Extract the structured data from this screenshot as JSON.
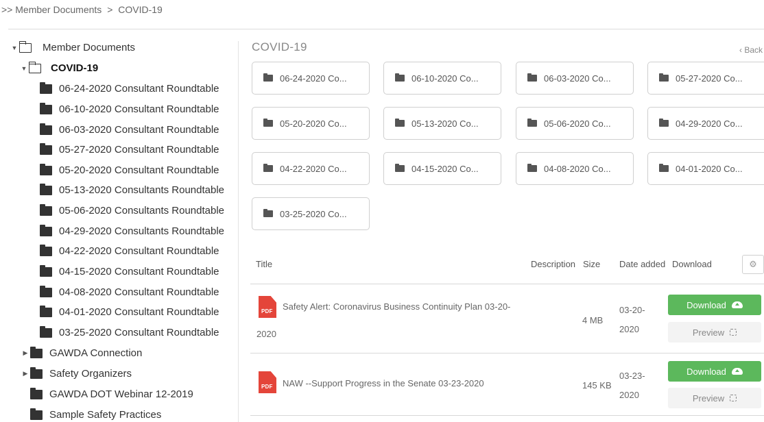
{
  "breadcrumb": {
    "prefix": ">> Member Documents",
    "sep": ">",
    "current": "COVID-19"
  },
  "tree": {
    "root": "Member Documents",
    "open_folder": "COVID-19",
    "children": [
      "06-24-2020 Consultant Roundtable",
      "06-10-2020 Consultant Roundtable",
      "06-03-2020 Consultant Roundtable",
      "05-27-2020 Consultant Roundtable",
      "05-20-2020 Consultant Roundtable",
      "05-13-2020 Consultants Roundtable",
      "05-06-2020 Consultants Roundtable",
      "04-29-2020 Consultants Roundtable",
      "04-22-2020 Consultant Roundtable",
      "04-15-2020 Consultant Roundtable",
      "04-08-2020 Consultant Roundtable",
      "04-01-2020 Consultant Roundtable",
      "03-25-2020 Consultant Roundtable"
    ],
    "siblings": [
      {
        "label": "GAWDA Connection",
        "expandable": true
      },
      {
        "label": "Safety Organizers",
        "expandable": true
      },
      {
        "label": "GAWDA DOT Webinar 12-2019",
        "expandable": false
      },
      {
        "label": "Sample Safety Practices",
        "expandable": false
      }
    ]
  },
  "main": {
    "title": "COVID-19",
    "back_label": "‹ Back",
    "folders": [
      "06-24-2020 Co...",
      "06-10-2020 Co...",
      "06-03-2020 Co...",
      "05-27-2020 Co...",
      "05-20-2020 Co...",
      "05-13-2020 Co...",
      "05-06-2020 Co...",
      "04-29-2020 Co...",
      "04-22-2020 Co...",
      "04-15-2020 Co...",
      "04-08-2020 Co...",
      "04-01-2020 Co...",
      "03-25-2020 Co..."
    ]
  },
  "table": {
    "headers": {
      "title": "Title",
      "description": "Description",
      "size": "Size",
      "date": "Date added",
      "download": "Download"
    },
    "settings_icon": "gear-icon",
    "rows": [
      {
        "file_type": "PDF",
        "title_line1": "Safety Alert: Coronavirus Business Continuity Plan 03-20-",
        "title_line2": "2020",
        "size": "4 MB",
        "date_line1": "03-20-",
        "date_line2": "2020",
        "download_label": "Download",
        "preview_label": "Preview"
      },
      {
        "file_type": "PDF",
        "title_line1": "NAW --Support Progress in the Senate 03-23-2020",
        "title_line2": "",
        "size": "145 KB",
        "date_line1": "03-23-",
        "date_line2": "2020",
        "download_label": "Download",
        "preview_label": "Preview"
      }
    ]
  },
  "colors": {
    "download_green": "#5cb85c",
    "pdf_red": "#e4453a"
  }
}
